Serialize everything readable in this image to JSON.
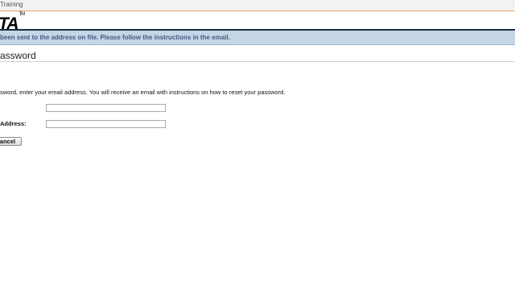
{
  "topbar": {
    "text": "Training"
  },
  "logo": {
    "text": "TA",
    "trademark": "TM"
  },
  "banner": {
    "message": "been sent to the address on file. Please follow the instructions in the email."
  },
  "page": {
    "title": "assword"
  },
  "form": {
    "instructions": "sword, enter your email address. You will receive an email with instructions on how to reset your password.",
    "field1_label": "",
    "field1_value": "",
    "field2_label": "Address:",
    "field2_value": "",
    "cancel_label": "ancel"
  },
  "colors": {
    "banner_bg": "#c4d6e6",
    "banner_text": "#435a84",
    "dark_rule": "#1c2b47",
    "topbar_border": "#e7a65c"
  }
}
